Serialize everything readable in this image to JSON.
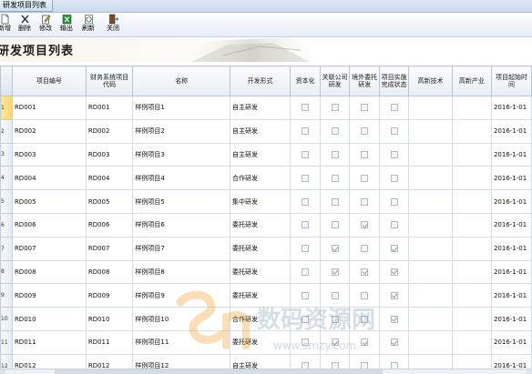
{
  "window": {
    "title": "研发项目列表"
  },
  "toolbar": [
    {
      "key": "new",
      "label": "新增",
      "icon": "new-document-icon"
    },
    {
      "key": "delete",
      "label": "删除",
      "icon": "delete-x-icon"
    },
    {
      "key": "edit",
      "label": "修改",
      "icon": "edit-pencil-icon"
    },
    {
      "key": "export",
      "label": "输出",
      "icon": "export-excel-icon"
    },
    {
      "key": "refresh",
      "label": "刷新",
      "icon": "refresh-icon"
    },
    {
      "key": "close",
      "label": "关闭",
      "icon": "close-door-icon"
    }
  ],
  "section": {
    "title": "研发项目列表"
  },
  "grid": {
    "columns": [
      "项目编号",
      "财务系统项目代码",
      "名称",
      "开发形式",
      "资本化",
      "关联公司研发",
      "境外委托研发",
      "项目实施完成状态",
      "高新技术",
      "高新产业",
      "项目起始时间"
    ],
    "rows": [
      {
        "row_no": "1",
        "id": "RD001",
        "fin_code": "RD001",
        "name": "样例项目1",
        "dev_form": "自主研发",
        "capitalized": false,
        "related_rd": false,
        "overseas_rd": false,
        "completed": false,
        "hi_tech": "",
        "hi_industry": "",
        "start": "2016-1-01"
      },
      {
        "row_no": "2",
        "id": "RD002",
        "fin_code": "RD002",
        "name": "样例项目2",
        "dev_form": "自主研发",
        "capitalized": false,
        "related_rd": false,
        "overseas_rd": false,
        "completed": false,
        "hi_tech": "",
        "hi_industry": "",
        "start": "2016-1-01"
      },
      {
        "row_no": "3",
        "id": "RD003",
        "fin_code": "RD003",
        "name": "样例项目3",
        "dev_form": "自主研发",
        "capitalized": false,
        "related_rd": false,
        "overseas_rd": false,
        "completed": false,
        "hi_tech": "",
        "hi_industry": "",
        "start": "2016-1-01"
      },
      {
        "row_no": "4",
        "id": "RD004",
        "fin_code": "RD004",
        "name": "样例项目4",
        "dev_form": "合作研发",
        "capitalized": false,
        "related_rd": false,
        "overseas_rd": false,
        "completed": false,
        "hi_tech": "",
        "hi_industry": "",
        "start": "2016-1-01"
      },
      {
        "row_no": "5",
        "id": "RD005",
        "fin_code": "RD005",
        "name": "样例项目5",
        "dev_form": "集中研发",
        "capitalized": false,
        "related_rd": false,
        "overseas_rd": false,
        "completed": false,
        "hi_tech": "",
        "hi_industry": "",
        "start": "2016-1-01"
      },
      {
        "row_no": "6",
        "id": "RD006",
        "fin_code": "RD006",
        "name": "样例项目6",
        "dev_form": "委托研发",
        "capitalized": false,
        "related_rd": false,
        "overseas_rd": true,
        "completed": false,
        "hi_tech": "",
        "hi_industry": "",
        "start": "2016-1-01"
      },
      {
        "row_no": "7",
        "id": "RD007",
        "fin_code": "RD007",
        "name": "样例项目7",
        "dev_form": "委托研发",
        "capitalized": false,
        "related_rd": true,
        "overseas_rd": false,
        "completed": true,
        "hi_tech": "",
        "hi_industry": "",
        "start": "2016-1-01"
      },
      {
        "row_no": "8",
        "id": "RD008",
        "fin_code": "RD008",
        "name": "样例项目8",
        "dev_form": "委托研发",
        "capitalized": false,
        "related_rd": true,
        "overseas_rd": true,
        "completed": true,
        "hi_tech": "",
        "hi_industry": "",
        "start": "2016-1-01"
      },
      {
        "row_no": "9",
        "id": "RD009",
        "fin_code": "RD009",
        "name": "样例项目9",
        "dev_form": "委托研发",
        "capitalized": false,
        "related_rd": false,
        "overseas_rd": false,
        "completed": true,
        "hi_tech": "",
        "hi_industry": "",
        "start": "2016-1-01"
      },
      {
        "row_no": "10",
        "id": "RD010",
        "fin_code": "RD010",
        "name": "样例项目10",
        "dev_form": "合作研发",
        "capitalized": false,
        "related_rd": false,
        "overseas_rd": false,
        "completed": true,
        "hi_tech": "",
        "hi_industry": "",
        "start": "2016-1-01"
      },
      {
        "row_no": "11",
        "id": "RD011",
        "fin_code": "RD011",
        "name": "样例项目11",
        "dev_form": "委托研发",
        "capitalized": false,
        "related_rd": true,
        "overseas_rd": true,
        "completed": true,
        "hi_tech": "",
        "hi_industry": "",
        "start": "2016-1-01"
      },
      {
        "row_no": "12",
        "id": "RD012",
        "fin_code": "RD012",
        "name": "样例项目12",
        "dev_form": "自主研发",
        "capitalized": false,
        "related_rd": false,
        "overseas_rd": false,
        "completed": false,
        "hi_tech": "",
        "hi_industry": "",
        "start": "2016-1-01"
      }
    ]
  },
  "watermark": {
    "text": "数码资源网",
    "url_text": "www.smzy.com"
  }
}
